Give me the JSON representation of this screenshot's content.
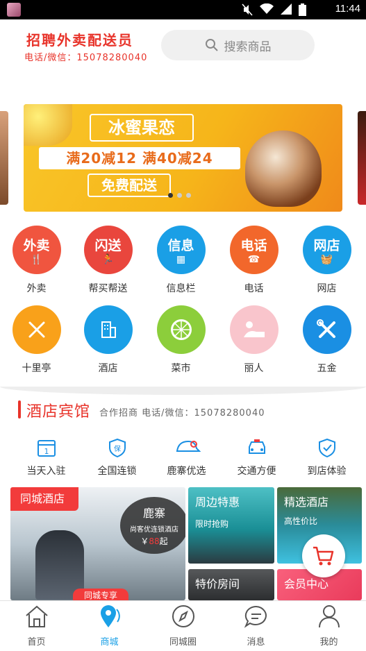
{
  "status_bar": {
    "time": "11:44",
    "icons": [
      "mute-icon",
      "wifi-icon",
      "signal-icon",
      "battery-icon"
    ]
  },
  "header": {
    "brand_title": "招聘外卖配送员",
    "brand_sub": "电话/微信：15078280040",
    "search_placeholder": "搜索商品"
  },
  "banner": {
    "title": "冰蜜果恋",
    "deal": "满20减12 满40减24",
    "free": "免费配送",
    "active_slide": 1,
    "slide_count": 3
  },
  "categories": [
    {
      "label": "外卖",
      "icon_text": "外卖",
      "color": "#f0553f"
    },
    {
      "label": "帮买帮送",
      "icon_text": "闪送",
      "color": "#e9463d"
    },
    {
      "label": "信息栏",
      "icon_text": "信息",
      "color": "#1a9fe6"
    },
    {
      "label": "电话",
      "icon_text": "电话",
      "color": "#f2672b"
    },
    {
      "label": "网店",
      "icon_text": "网店",
      "color": "#1a9fe6"
    },
    {
      "label": "十里亭",
      "icon": "fork-knife-icon",
      "color": "#f9a11a"
    },
    {
      "label": "酒店",
      "icon": "building-icon",
      "color": "#1a9fe6"
    },
    {
      "label": "菜市",
      "icon": "lemon-icon",
      "color": "#8cce3b"
    },
    {
      "label": "丽人",
      "icon": "spa-icon",
      "color": "#f27e90"
    },
    {
      "label": "五金",
      "icon": "tools-icon",
      "color": "#1a8fe3"
    }
  ],
  "section": {
    "title": "酒店宾馆",
    "subtitle": "合作招商 电话/微信：15078280040"
  },
  "features": [
    {
      "label": "当天入驻",
      "icon": "calendar-icon"
    },
    {
      "label": "全国连锁",
      "icon": "shield-icon"
    },
    {
      "label": "鹿寨优选",
      "icon": "cap-icon"
    },
    {
      "label": "交通方便",
      "icon": "car-icon"
    },
    {
      "label": "到店体验",
      "icon": "check-shield-icon"
    }
  ],
  "tiles": {
    "hotel": {
      "tag": "同城酒店",
      "bubble_name": "鹿寨",
      "bubble_desc": "尚客优连锁酒店",
      "price_symbol": "￥",
      "price": "88",
      "price_suffix": "起",
      "banner": "同城专享"
    },
    "nearby": {
      "title": "周边特惠",
      "sub": "限时抢购"
    },
    "picks": {
      "title": "精选酒店",
      "sub": "高性价比"
    },
    "special": {
      "title": "特价房间"
    },
    "member": {
      "title": "会员中心"
    }
  },
  "tabbar": [
    {
      "label": "首页",
      "icon": "home-icon"
    },
    {
      "label": "商城",
      "icon": "location-icon",
      "active": true
    },
    {
      "label": "同城圈",
      "icon": "compass-icon"
    },
    {
      "label": "消息",
      "icon": "chat-icon"
    },
    {
      "label": "我的",
      "icon": "user-icon"
    }
  ],
  "colors": {
    "brand_red": "#e8332a",
    "accent_blue": "#1aa0e6"
  }
}
